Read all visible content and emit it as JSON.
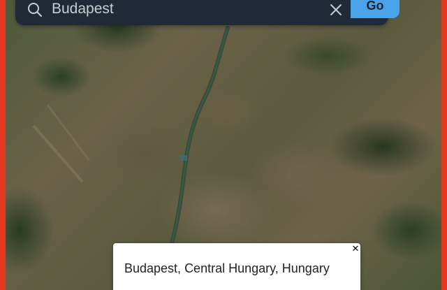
{
  "search": {
    "value": "Budapest",
    "go_label": "Go"
  },
  "icons": {
    "search": "search-icon",
    "clear": "close-icon",
    "popup_close": "close-icon"
  },
  "popup": {
    "text": "Budapest, Central Hungary, Hungary",
    "close_glyph": "✕"
  },
  "colors": {
    "border_accent": "#e5391f",
    "search_bar_bg": "#1f2937",
    "go_button": "#4aa3e8"
  }
}
